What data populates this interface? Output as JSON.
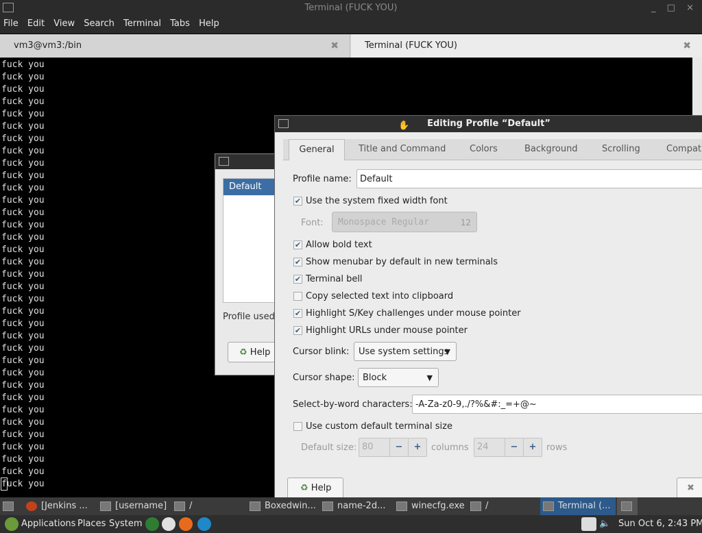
{
  "window": {
    "title": "Terminal (FUCK YOU)",
    "controls": "_ □ ×"
  },
  "menu": [
    "File",
    "Edit",
    "View",
    "Search",
    "Terminal",
    "Tabs",
    "Help"
  ],
  "tabs": [
    {
      "label": "vm3@vm3:/bin",
      "close": "✖"
    },
    {
      "label": "Terminal (FUCK YOU)",
      "close": "✖"
    }
  ],
  "terminal": {
    "lines": [
      "fuck you",
      "fuck you",
      "fuck you",
      "fuck you",
      "fuck you",
      "fuck you",
      "fuck you",
      "fuck you",
      "fuck you",
      "fuck you",
      "fuck you",
      "fuck you",
      "fuck you",
      "fuck you",
      "fuck you",
      "fuck you",
      "fuck you",
      "fuck you",
      "fuck you",
      "fuck you",
      "fuck you",
      "fuck you",
      "fuck you",
      "fuck you",
      "fuck you",
      "fuck you",
      "fuck you",
      "fuck you",
      "fuck you",
      "fuck you",
      "fuck you",
      "fuck you",
      "fuck you",
      "fuck you",
      "fuck you"
    ]
  },
  "profiles_dialog": {
    "selected_profile": "Default",
    "profile_used_label": "Profile used",
    "help_label": "Help"
  },
  "editor": {
    "title": "Editing Profile “Default”",
    "tabs": [
      "General",
      "Title and Command",
      "Colors",
      "Background",
      "Scrolling",
      "Compati"
    ],
    "profile_name_label": "Profile name:",
    "profile_name_value": "Default",
    "use_system_font": "Use the system fixed width font",
    "font_label": "Font:",
    "font_value": "Monospace Regular",
    "font_size": "12",
    "allow_bold": "Allow bold text",
    "show_menubar": "Show menubar by default in new terminals",
    "terminal_bell": "Terminal bell",
    "copy_selected": "Copy selected text into clipboard",
    "highlight_skey": "Highlight S/Key challenges under mouse pointer",
    "highlight_urls": "Highlight URLs under mouse pointer",
    "cursor_blink_label": "Cursor blink:",
    "cursor_blink_value": "Use system settings",
    "cursor_shape_label": "Cursor shape:",
    "cursor_shape_value": "Block",
    "select_by_word_label": "Select-by-word characters:",
    "select_by_word_value": "-A-Za-z0-9,./?%&#:_=+@~",
    "custom_size": "Use custom default terminal size",
    "default_size_label": "Default size:",
    "columns_value": "80",
    "columns_label": "columns",
    "rows_value": "24",
    "rows_label": "rows",
    "help_label": "Help",
    "close_label": "C"
  },
  "taskbar": {
    "items": [
      "[Jenkins ...",
      "[username]",
      "/",
      "Boxedwin...",
      "name-2d...",
      "winecfg.exe",
      "/",
      "Terminal (..."
    ]
  },
  "panel": {
    "applications": "Applications",
    "places": "Places",
    "system": "System",
    "clock": "Sun Oct  6,  2:43 PM"
  }
}
